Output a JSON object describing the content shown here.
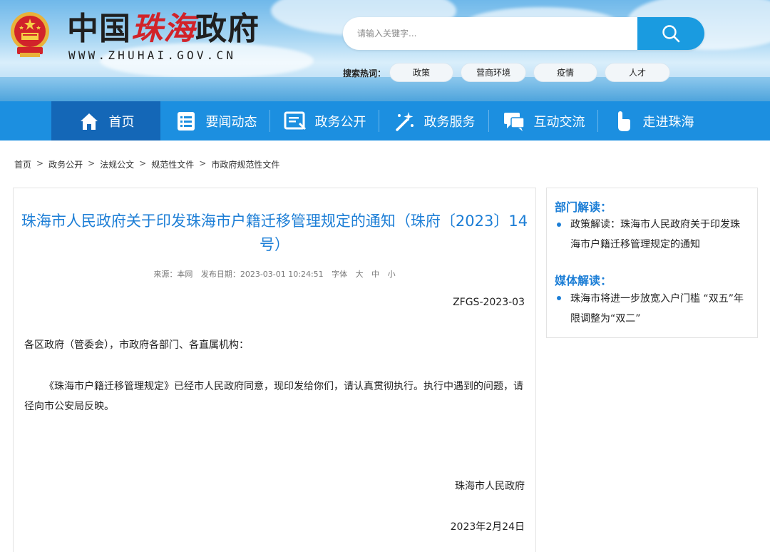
{
  "header": {
    "site_name_black1": "中国",
    "site_name_red": "珠海",
    "site_name_black2": "政府",
    "site_url": "WWW.ZHUHAI.GOV.CN",
    "emblem_icon": "national-emblem-icon"
  },
  "search": {
    "placeholder": "请输入关键字...",
    "button_icon": "search-icon",
    "hot_label": "搜索热词：",
    "hot_tags": [
      "政策",
      "营商环境",
      "疫情",
      "人才"
    ]
  },
  "nav": {
    "items": [
      {
        "label": "首页",
        "icon": "home-icon"
      },
      {
        "label": "要闻动态",
        "icon": "news-list-icon"
      },
      {
        "label": "政务公开",
        "icon": "document-icon"
      },
      {
        "label": "政务服务",
        "icon": "magic-wand-icon"
      },
      {
        "label": "互动交流",
        "icon": "chat-icon"
      },
      {
        "label": "走进珠海",
        "icon": "pointer-hand-icon"
      }
    ],
    "active_index": 0,
    "colors": {
      "bar": "#1c8fe0",
      "active": "#1467b7"
    }
  },
  "breadcrumb": {
    "items": [
      "首页",
      "政务公开",
      "法规公文",
      "规范性文件",
      "市政府规范性文件"
    ],
    "separator": ">"
  },
  "article": {
    "title": "珠海市人民政府关于印发珠海市户籍迁移管理规定的通知（珠府〔2023〕14号）",
    "meta": {
      "source_label": "来源：本网",
      "date_label": "发布日期：2023-03-01 10:24:51",
      "font_label": "字体",
      "font_large": "大",
      "font_medium": "中",
      "font_small": "小"
    },
    "doc_number": "ZFGS-2023-03",
    "addressee": "各区政府（管委会），市政府各部门、各直属机构：",
    "body": "《珠海市户籍迁移管理规定》已经市人民政府同意，现印发给你们，请认真贯彻执行。执行中遇到的问题，请径向市公安局反映。",
    "signer": "珠海市人民政府",
    "date": "2023年2月24日"
  },
  "sidebar": {
    "dept_heading": "部门解读：",
    "dept_item": "政策解读：珠海市人民政府关于印发珠海市户籍迁移管理规定的通知",
    "media_heading": "媒体解读：",
    "media_item": "珠海市将进一步放宽入户门槛 “双五”年限调整为“双二”"
  },
  "colors": {
    "accent_blue": "#1c7ed6",
    "search_button": "#1a9be0",
    "brand_red": "#d1232a"
  }
}
